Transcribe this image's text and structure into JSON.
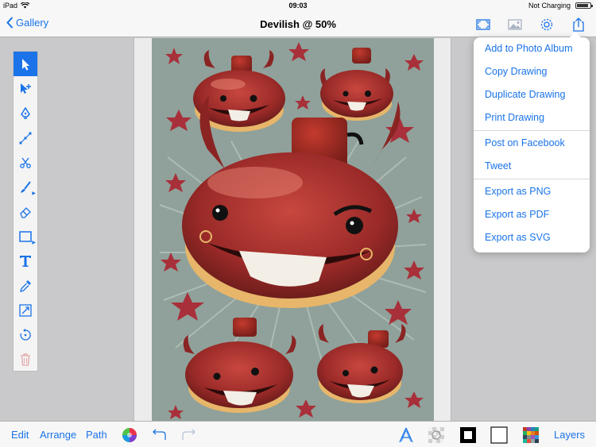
{
  "status": {
    "device": "iPad",
    "time": "09:03",
    "charging": "Not Charging",
    "battery_level": 0.85
  },
  "nav": {
    "back_label": "Gallery",
    "title": "Devilish @ 50%"
  },
  "menu": {
    "groups": [
      [
        "Add to Photo Album",
        "Copy Drawing",
        "Duplicate Drawing",
        "Print Drawing"
      ],
      [
        "Post on Facebook",
        "Tweet"
      ],
      [
        "Export as PNG",
        "Export as PDF",
        "Export as SVG"
      ]
    ]
  },
  "tools": [
    "select-arrow",
    "direct-select",
    "pen",
    "path-edit",
    "scissors",
    "brush",
    "eraser",
    "shape",
    "text",
    "eyedropper",
    "transform",
    "rotate",
    "trash"
  ],
  "bottom": {
    "edit": "Edit",
    "arrange": "Arrange",
    "path": "Path",
    "layers": "Layers"
  },
  "colors": {
    "accent": "#1a73e8",
    "artwork_bg": "#8fa19a",
    "devil_red": "#a52a2a",
    "star_red": "#a8303a"
  }
}
